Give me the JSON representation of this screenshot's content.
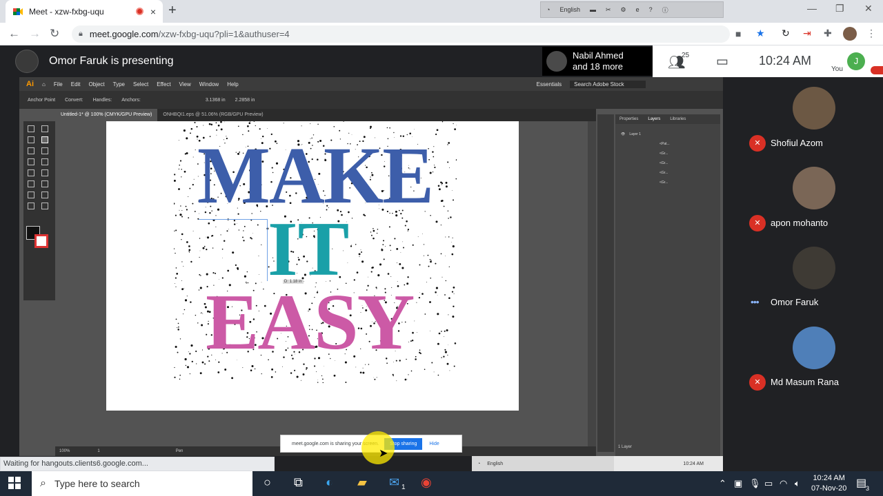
{
  "browser": {
    "tab_title": "Meet - xzw-fxbg-uqu",
    "tab_close": "×",
    "new_tab": "+",
    "url_host": "meet.google.com",
    "url_path": "/xzw-fxbg-uqu?pli=1&authuser=4",
    "ime_label": "English"
  },
  "meet": {
    "presenter_text": "Omor Faruk is presenting",
    "nabil_name": "Nabil Ahmed",
    "nabil_more": "and 18 more",
    "people_count": "25",
    "clock": "10:24 AM",
    "you_initial": "J",
    "you_label": "You",
    "share_text": "meet.google.com is sharing your screen.",
    "stop_sharing": "Stop sharing",
    "hide": "Hide",
    "status_text": "Waiting for hangouts.clients6.google.com...",
    "participants": [
      {
        "name": "Shofiul Azom",
        "state": "muted"
      },
      {
        "name": "apon mohanto",
        "state": "muted"
      },
      {
        "name": "Omor Faruk",
        "state": "speaking"
      },
      {
        "name": "Md Masum Rana",
        "state": "muted"
      }
    ]
  },
  "illustrator": {
    "menu": [
      "File",
      "Edit",
      "Object",
      "Type",
      "Select",
      "Effect",
      "View",
      "Window",
      "Help"
    ],
    "workspace": "Essentials",
    "search_placeholder": "Search Adobe Stock",
    "control": [
      "Anchor Point",
      "Convert:",
      "Handles:",
      "Anchors:"
    ],
    "width_value": "3.1368 in",
    "height_value": "2.2858 in",
    "doc_tab_active": "Untitled-1* @ 100% (CMYK/GPU Preview)",
    "doc_tab_other": "ONHBQI1.eps @ 51.06% (RGB/GPU Preview)",
    "art_words": [
      "MAKE",
      "IT",
      "EASY"
    ],
    "art_colors": {
      "make": "#3d5eaa",
      "it": "#1aa0a8",
      "easy": "#cc5aa6"
    },
    "distance_label": "D: 1.18 in",
    "panel_tabs": [
      "Properties",
      "Layers",
      "Libraries"
    ],
    "layer_name": "Layer 1",
    "layer_rows": [
      "<Pat...",
      "<Gr...",
      "<Gr...",
      "<Gr...",
      "<Gr..."
    ],
    "layers_count": "1 Layer",
    "zoom": "100%",
    "artboard_num": "1",
    "tool_name": "Pen",
    "inner_time": "10:24 AM"
  },
  "taskbar": {
    "search_placeholder": "Type here to search",
    "time": "10:24 AM",
    "date": "07-Nov-20",
    "mail_badge": "1",
    "notif_count": "3"
  }
}
